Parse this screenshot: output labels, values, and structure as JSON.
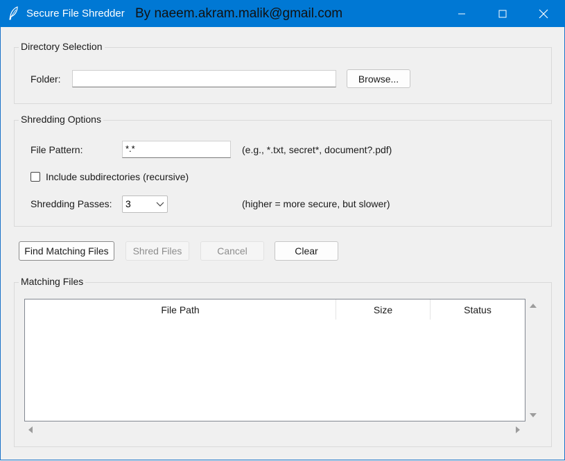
{
  "titlebar": {
    "app_icon": "feather-icon",
    "title": "Secure File Shredder",
    "author": "By naeem.akram.malik@gmail.com",
    "minimize_icon": "minimize-icon",
    "maximize_icon": "maximize-icon",
    "close_icon": "close-icon"
  },
  "directory_section": {
    "title": "Directory Selection",
    "folder_label": "Folder:",
    "folder_value": "",
    "browse_label": "Browse..."
  },
  "options_section": {
    "title": "Shredding Options",
    "pattern_label": "File Pattern:",
    "pattern_value": "*.*",
    "pattern_hint": "(e.g., *.txt, secret*, document?.pdf)",
    "recursive_label": "Include subdirectories (recursive)",
    "recursive_checked": false,
    "passes_label": "Shredding Passes:",
    "passes_value": "3",
    "passes_hint": "(higher = more secure, but slower)"
  },
  "actions": {
    "find_label": "Find Matching Files",
    "shred_label": "Shred Files",
    "cancel_label": "Cancel",
    "clear_label": "Clear"
  },
  "results_section": {
    "title": "Matching Files",
    "columns": [
      "File Path",
      "Size",
      "Status"
    ],
    "rows": []
  },
  "colors": {
    "titlebar": "#0078d4",
    "window_bg": "#f0f0f0"
  }
}
